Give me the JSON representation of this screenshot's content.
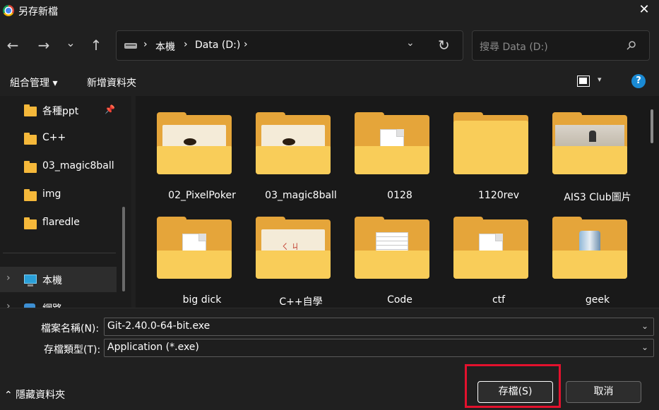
{
  "window": {
    "title": "另存新檔",
    "close_glyph": "✕"
  },
  "nav": {
    "back_glyph": "←",
    "forward_glyph": "→",
    "recent_glyph": "⌄",
    "up_glyph": "↑",
    "breadcrumb": [
      "本機",
      "Data (D:)"
    ],
    "breadcrumb_sep": "›",
    "dropdown_glyph": "⌄",
    "refresh_glyph": "↻"
  },
  "search": {
    "placeholder": "搜尋 Data (D:)"
  },
  "toolbar": {
    "organize_label": "組合管理 ▾",
    "new_folder_label": "新增資料夾",
    "view_dropdown_glyph": "▾",
    "help_glyph": "?"
  },
  "sidebar": {
    "pin_glyph": "📌",
    "items": [
      {
        "label": "各種ppt",
        "pinned": true
      },
      {
        "label": "C++"
      },
      {
        "label": "03_magic8ball"
      },
      {
        "label": "img"
      },
      {
        "label": "flaredle"
      }
    ],
    "this_pc": {
      "label": "本機",
      "chevron": "›"
    },
    "network": {
      "label": "網路",
      "chevron": "›"
    }
  },
  "files": [
    {
      "name": "02_PixelPoker"
    },
    {
      "name": "03_magic8ball"
    },
    {
      "name": "0128"
    },
    {
      "name": "1120rev"
    },
    {
      "name": "AIS3 Club圖片"
    },
    {
      "name": "big dick"
    },
    {
      "name": "C++自學"
    },
    {
      "name": "Code"
    },
    {
      "name": "ctf"
    },
    {
      "name": "geek"
    }
  ],
  "thumb_text": {
    "cxx_marks": "ㄑ ㄐ"
  },
  "form": {
    "filename_label": "檔案名稱(N):",
    "filename_value": "Git-2.40.0-64-bit.exe",
    "filetype_label": "存檔類型(T):",
    "filetype_value": "Application (*.exe)",
    "dropdown_glyph": "⌄"
  },
  "footer": {
    "hide_folders_label": "⌃ 隱藏資料夾",
    "save_label": "存檔(S)",
    "cancel_label": "取消"
  },
  "colors": {
    "background": "#202020",
    "folder_yellow": "#f9cd59",
    "accent_blue": "#1a8ad4",
    "highlight_red": "#e3112d"
  }
}
